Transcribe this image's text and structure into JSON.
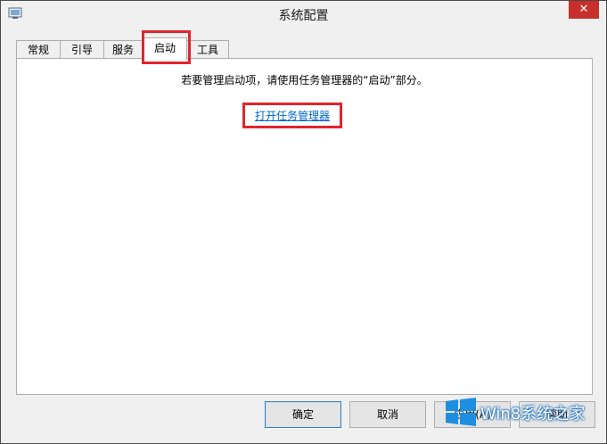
{
  "window": {
    "title": "系统配置",
    "close_label": "✕"
  },
  "tabs": [
    {
      "label": "常规"
    },
    {
      "label": "引导"
    },
    {
      "label": "服务"
    },
    {
      "label": "启动",
      "active": true
    },
    {
      "label": "工具"
    }
  ],
  "startup": {
    "info_text": "若要管理启动项，请使用任务管理器的“启动”部分。",
    "link_text": "打开任务管理器"
  },
  "buttons": {
    "ok": "确定",
    "cancel": "取消",
    "apply": "应用(A)",
    "help": "帮助"
  },
  "watermark": {
    "text": "Win8系统之家"
  },
  "colors": {
    "highlight": "#e3242b",
    "link": "#0066cc",
    "close": "#c7302a"
  }
}
